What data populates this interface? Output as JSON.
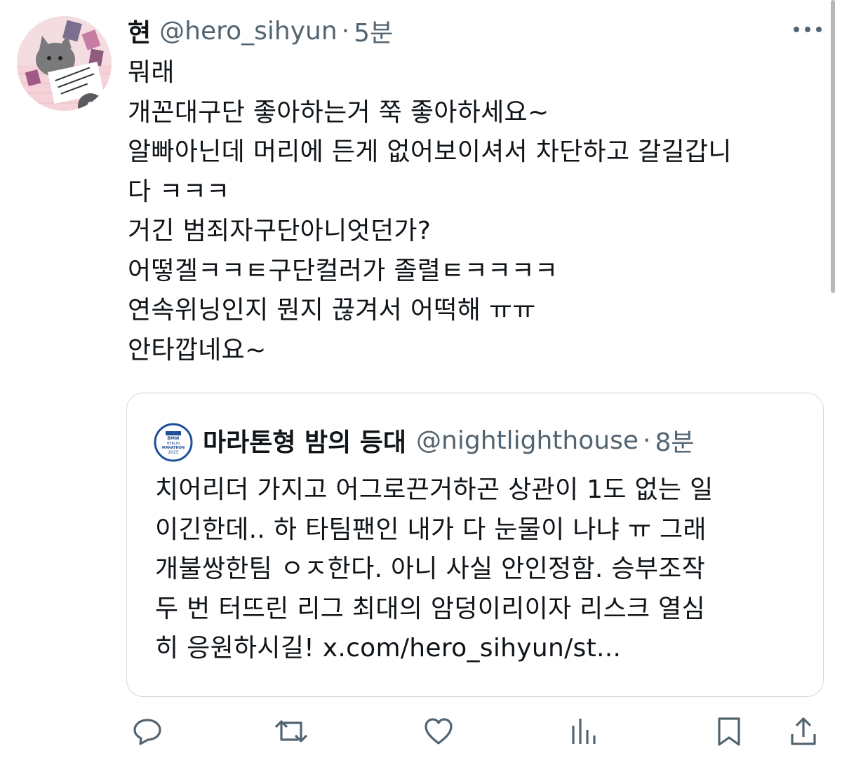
{
  "tweet": {
    "author_name": "현",
    "author_handle": "@hero_sihyun",
    "separator": "·",
    "time": "5분",
    "lines": [
      "뭐래",
      "개꼰대구단 좋아하는거 쭉 좋아하세요~",
      "알빠아닌데 머리에 든게 없어보이셔서 차단하고 갈길갑니",
      "다 ㅋㅋㅋ",
      "거긴 범죄자구단아니엇던가?",
      "어떻겔ㅋㅋㅌ구단컬러가 졸렬ㅌㅋㅋㅋㅋ",
      "연속위닝인지 뭔지 끊겨서 어떡해 ㅠㅠ",
      "안타깝네요~"
    ]
  },
  "quote": {
    "author_name": "마라톤형 밤의 등대",
    "author_handle": "@nightlighthouse",
    "separator": "·",
    "time": "8분",
    "badge_lines": [
      "BMW",
      "BERLIN",
      "MARATHON",
      "2025"
    ],
    "lines": [
      "치어리더 가지고 어그로끈거하곤 상관이 1도 없는 일",
      "이긴한데.. 하 타팀팬인 내가 다 눈물이 나냐 ㅠ 그래",
      "개불쌍한팀 ㅇㅈ한다. 아니 사실 안인정함. 승부조작",
      "두 번 터뜨린 리그 최대의 암덩이리이자 리스크 열심",
      "히 응원하시길! x.com/hero_sihyun/st..."
    ]
  },
  "icons": {
    "more": "more-dots-icon",
    "reply": "reply-icon",
    "retweet": "retweet-icon",
    "like": "heart-icon",
    "views": "views-icon",
    "bookmark": "bookmark-icon",
    "share": "share-icon"
  },
  "colors": {
    "text": "#0f1419",
    "secondary": "#536471",
    "border": "#cfd9de",
    "badge_blue": "#1f4e9a"
  }
}
